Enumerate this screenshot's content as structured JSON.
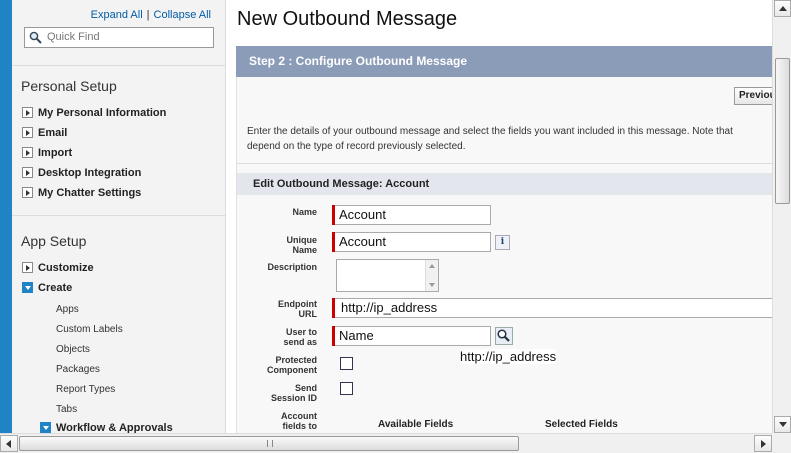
{
  "sidebar": {
    "expand_all": "Expand All",
    "separator": "|",
    "collapse_all": "Collapse All",
    "quick_find_placeholder": "Quick Find",
    "personal_title": "Personal Setup",
    "personal_items": [
      "My Personal Information",
      "Email",
      "Import",
      "Desktop Integration",
      "My Chatter Settings"
    ],
    "app_title": "App Setup",
    "customize": "Customize",
    "create": "Create",
    "create_children": [
      "Apps",
      "Custom Labels",
      "Objects",
      "Packages",
      "Report Types",
      "Tabs"
    ],
    "workflow": "Workflow & Approvals"
  },
  "main": {
    "title": "New Outbound Message",
    "step": "Step 2 : Configure Outbound Message",
    "previous_button": "Previous",
    "intro_line1": "Enter the details of your outbound message and select the fields you want included in this message. Note that",
    "intro_line2": "depend on the type of record previously selected.",
    "edit_header": "Edit Outbound Message: Account",
    "required_legend": "=",
    "form": {
      "name_label": "Name",
      "name_value": "Account",
      "unique_label_1": "Unique",
      "unique_label_2": "Name",
      "unique_value": "Account",
      "info_glyph": "i",
      "description_label": "Description",
      "endpoint_label_1": "Endpoint",
      "endpoint_label_2": "URL",
      "endpoint_value": "http://ip_address",
      "user_label_1": "User to",
      "user_label_2": "send as",
      "user_value": "Name",
      "tooltip": "http://ip_address",
      "protected_label_1": "Protected",
      "protected_label_2": "Component",
      "send_session_label_1": "Send",
      "send_session_label_2": "Session ID",
      "account_fields_label_1": "Account",
      "account_fields_label_2": "fields to",
      "available_fields": "Available Fields",
      "selected_fields": "Selected Fields"
    }
  },
  "scrollbar": {
    "grip": "|||"
  },
  "colors": {
    "accent_blue": "#1f83c6",
    "step_bar": "#8b9cb9",
    "required_red": "#cc0000",
    "link": "#015ba7"
  }
}
